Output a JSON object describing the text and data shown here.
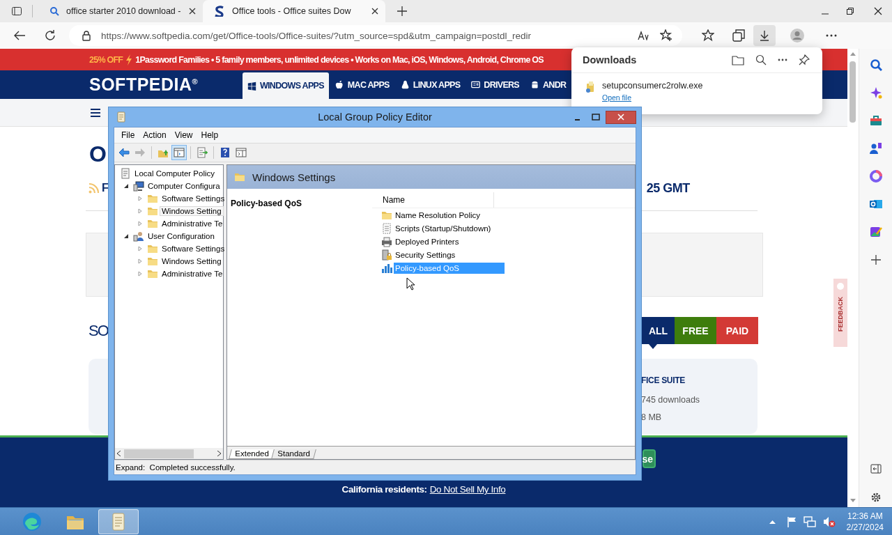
{
  "browser": {
    "tabs": [
      {
        "title": "office starter 2010 download -",
        "kind": "search",
        "selected": false
      },
      {
        "title": "Office tools - Office suites Dow",
        "kind": "site",
        "selected": true
      }
    ],
    "url": "https://www.softpedia.com/get/Office-tools/Office-suites/?utm_source=spd&utm_campaign=postdl_redir",
    "downloads_open": true
  },
  "site": {
    "promo": {
      "offer": "25% OFF",
      "text": "1Password Families • 5 family members, unlimited devices • Works on Mac, iOS, Windows, Android, Chrome OS"
    },
    "logo": "SOFTPEDIA$^{®}$",
    "nav": [
      {
        "label": "WINDOWS APPS",
        "kind": "windows",
        "selected": true
      },
      {
        "label": "MAC APPS",
        "kind": "apple",
        "selected": false
      },
      {
        "label": "LINUX APPS",
        "kind": "linux",
        "selected": false
      },
      {
        "label": "DRIVERS",
        "kind": "drivers",
        "selected": false
      },
      {
        "label": "ANDR",
        "kind": "android",
        "selected": false
      }
    ],
    "title": "O",
    "feed_label": "F",
    "updated": "25 GMT",
    "section": "SO",
    "filters": [
      {
        "label": "ALL",
        "selected": true,
        "color": "#0a2a6b"
      },
      {
        "label": "FREE",
        "selected": false,
        "color": "#3e7d0c"
      },
      {
        "label": "PAID",
        "selected": false,
        "color": "#d33a35"
      }
    ],
    "card": {
      "title": "FICE SUITE",
      "downloads": "745 downloads",
      "size": "8 MB"
    },
    "footer": {
      "button": "se",
      "note": "California residents:",
      "link": "Do Not Sell My Info"
    },
    "feedback": "FEEDBACK"
  },
  "downloads": {
    "title": "Downloads",
    "items": [
      {
        "file": "setupconsumerc2rolw.exe",
        "action": "Open file"
      }
    ]
  },
  "editor": {
    "title": "Local Group Policy Editor",
    "menu": [
      "File",
      "Action",
      "View",
      "Help"
    ],
    "toolbar": [
      {
        "kind": "back",
        "pressed": false,
        "disabled": false
      },
      {
        "kind": "forward",
        "pressed": false,
        "disabled": true
      },
      {
        "kind": "up",
        "pressed": false,
        "disabled": false
      },
      {
        "kind": "tree",
        "pressed": true,
        "disabled": false
      },
      {
        "kind": "export",
        "pressed": false,
        "disabled": false
      },
      {
        "kind": "help",
        "pressed": false,
        "disabled": false
      },
      {
        "kind": "console",
        "pressed": false,
        "disabled": false
      }
    ],
    "tree": [
      {
        "label": "Local Computer Policy",
        "kind": "policy",
        "selected": false,
        "children": [
          {
            "label": "Computer Configura",
            "kind": "computer",
            "expanded": true,
            "selected": false,
            "children": [
              {
                "label": "Software Settings",
                "kind": "folder",
                "expanded": false,
                "selected": false
              },
              {
                "label": "Windows Setting",
                "kind": "folder",
                "expanded": false,
                "selected": true
              },
              {
                "label": "Administrative Te",
                "kind": "folder",
                "expanded": false,
                "selected": false
              }
            ]
          },
          {
            "label": "User Configuration",
            "kind": "user",
            "expanded": true,
            "selected": false,
            "children": [
              {
                "label": "Software Settings",
                "kind": "folder",
                "expanded": false,
                "selected": false
              },
              {
                "label": "Windows Setting",
                "kind": "folder",
                "expanded": false,
                "selected": false
              },
              {
                "label": "Administrative Te",
                "kind": "folder",
                "expanded": false,
                "selected": false
              }
            ]
          }
        ]
      }
    ],
    "header": "Windows Settings",
    "description_title": "Policy-based QoS",
    "columns": [
      "Name"
    ],
    "items": [
      {
        "name": "Name Resolution Policy",
        "kind": "folder",
        "selected": false
      },
      {
        "name": "Scripts (Startup/Shutdown)",
        "kind": "script",
        "selected": false
      },
      {
        "name": "Deployed Printers",
        "kind": "printer",
        "selected": false
      },
      {
        "name": "Security Settings",
        "kind": "security",
        "selected": false
      },
      {
        "name": "Policy-based QoS",
        "kind": "qos",
        "selected": true
      }
    ],
    "view_tabs": [
      {
        "label": "Extended",
        "selected": true
      },
      {
        "label": "Standard",
        "selected": false
      }
    ],
    "status": "Expand:  Completed successfully."
  },
  "taskbar": {
    "apps": [
      {
        "kind": "edge",
        "active": false
      },
      {
        "kind": "explorer",
        "active": false
      },
      {
        "kind": "policy",
        "active": true
      }
    ],
    "time": "12:36 AM",
    "date": "2/27/2024"
  }
}
